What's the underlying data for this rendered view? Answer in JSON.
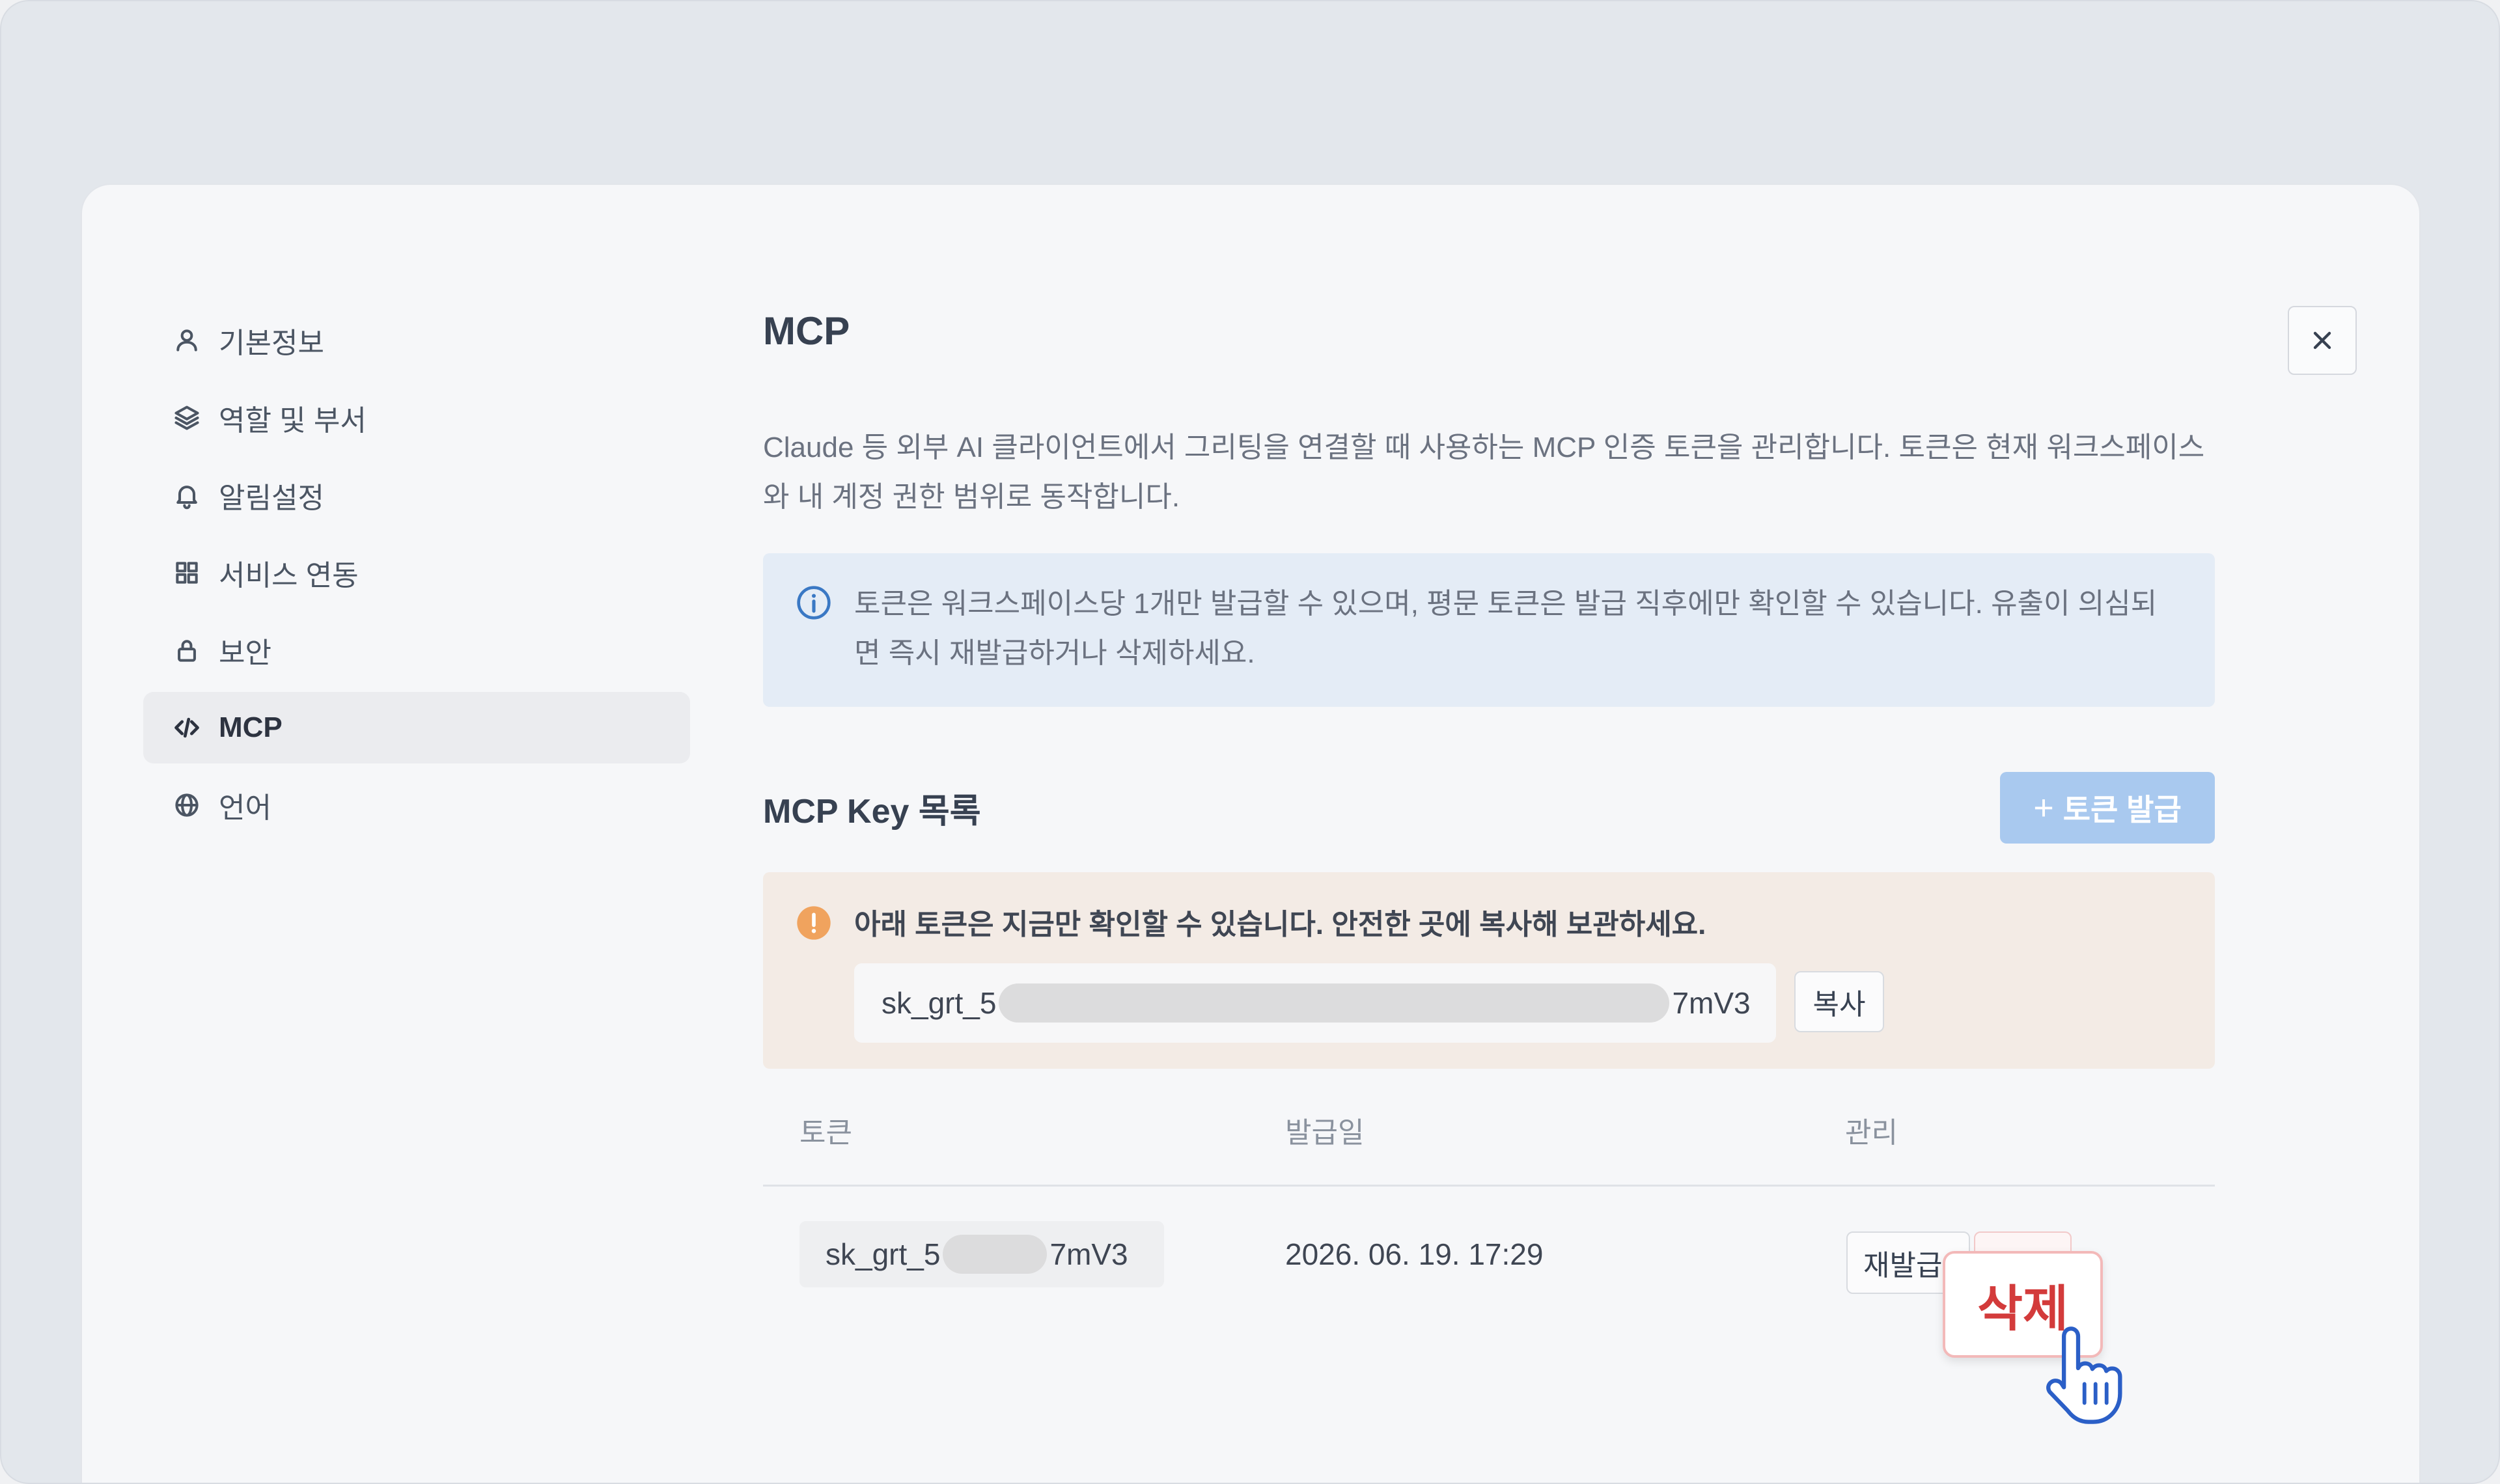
{
  "sidebar": {
    "items": [
      {
        "label": "기본정보",
        "icon": "user-icon"
      },
      {
        "label": "역할 및 부서",
        "icon": "layers-icon"
      },
      {
        "label": "알림설정",
        "icon": "bell-icon"
      },
      {
        "label": "서비스 연동",
        "icon": "grid-icon"
      },
      {
        "label": "보안",
        "icon": "lock-icon"
      },
      {
        "label": "MCP",
        "icon": "code-icon",
        "active": true
      },
      {
        "label": "언어",
        "icon": "globe-icon"
      }
    ]
  },
  "page": {
    "title": "MCP",
    "description": "Claude 등 외부 AI 클라이언트에서 그리팅을 연결할 때 사용하는 MCP 인증 토큰을 관리합니다. 토큰은 현재 워크스페이스와 내 계정 권한 범위로 동작합니다.",
    "info": "토큰은 워크스페이스당 1개만 발급할 수 있으며, 평문 토큰은 발급 직후에만 확인할 수 있습니다. 유출이 의심되면 즉시 재발급하거나 삭제하세요."
  },
  "keys": {
    "title": "MCP Key 목록",
    "issue_button": "토큰 발급",
    "issue_plus": "+",
    "warning": "아래 토큰은 지금만 확인할 수 있습니다. 안전한 곳에 복사해 보관하세요.",
    "new_token_prefix": "sk_grt_5",
    "new_token_suffix": "7mV3",
    "copy_button": "복사"
  },
  "table": {
    "headers": {
      "token": "토큰",
      "issued": "발급일",
      "manage": "관리"
    },
    "rows": [
      {
        "token_prefix": "sk_grt_5",
        "token_suffix": "7mV3",
        "issued": "2026. 06. 19. 17:29",
        "reissue": "재발급",
        "delete": "삭제"
      }
    ]
  },
  "colors": {
    "accent_disabled": "#a9c9ef",
    "info_bg": "#e4ecf6",
    "warn_bg": "#f3ebe5",
    "warn_icon": "#f0a35e",
    "info_icon": "#3a78c4",
    "danger": "#d33b3b"
  }
}
